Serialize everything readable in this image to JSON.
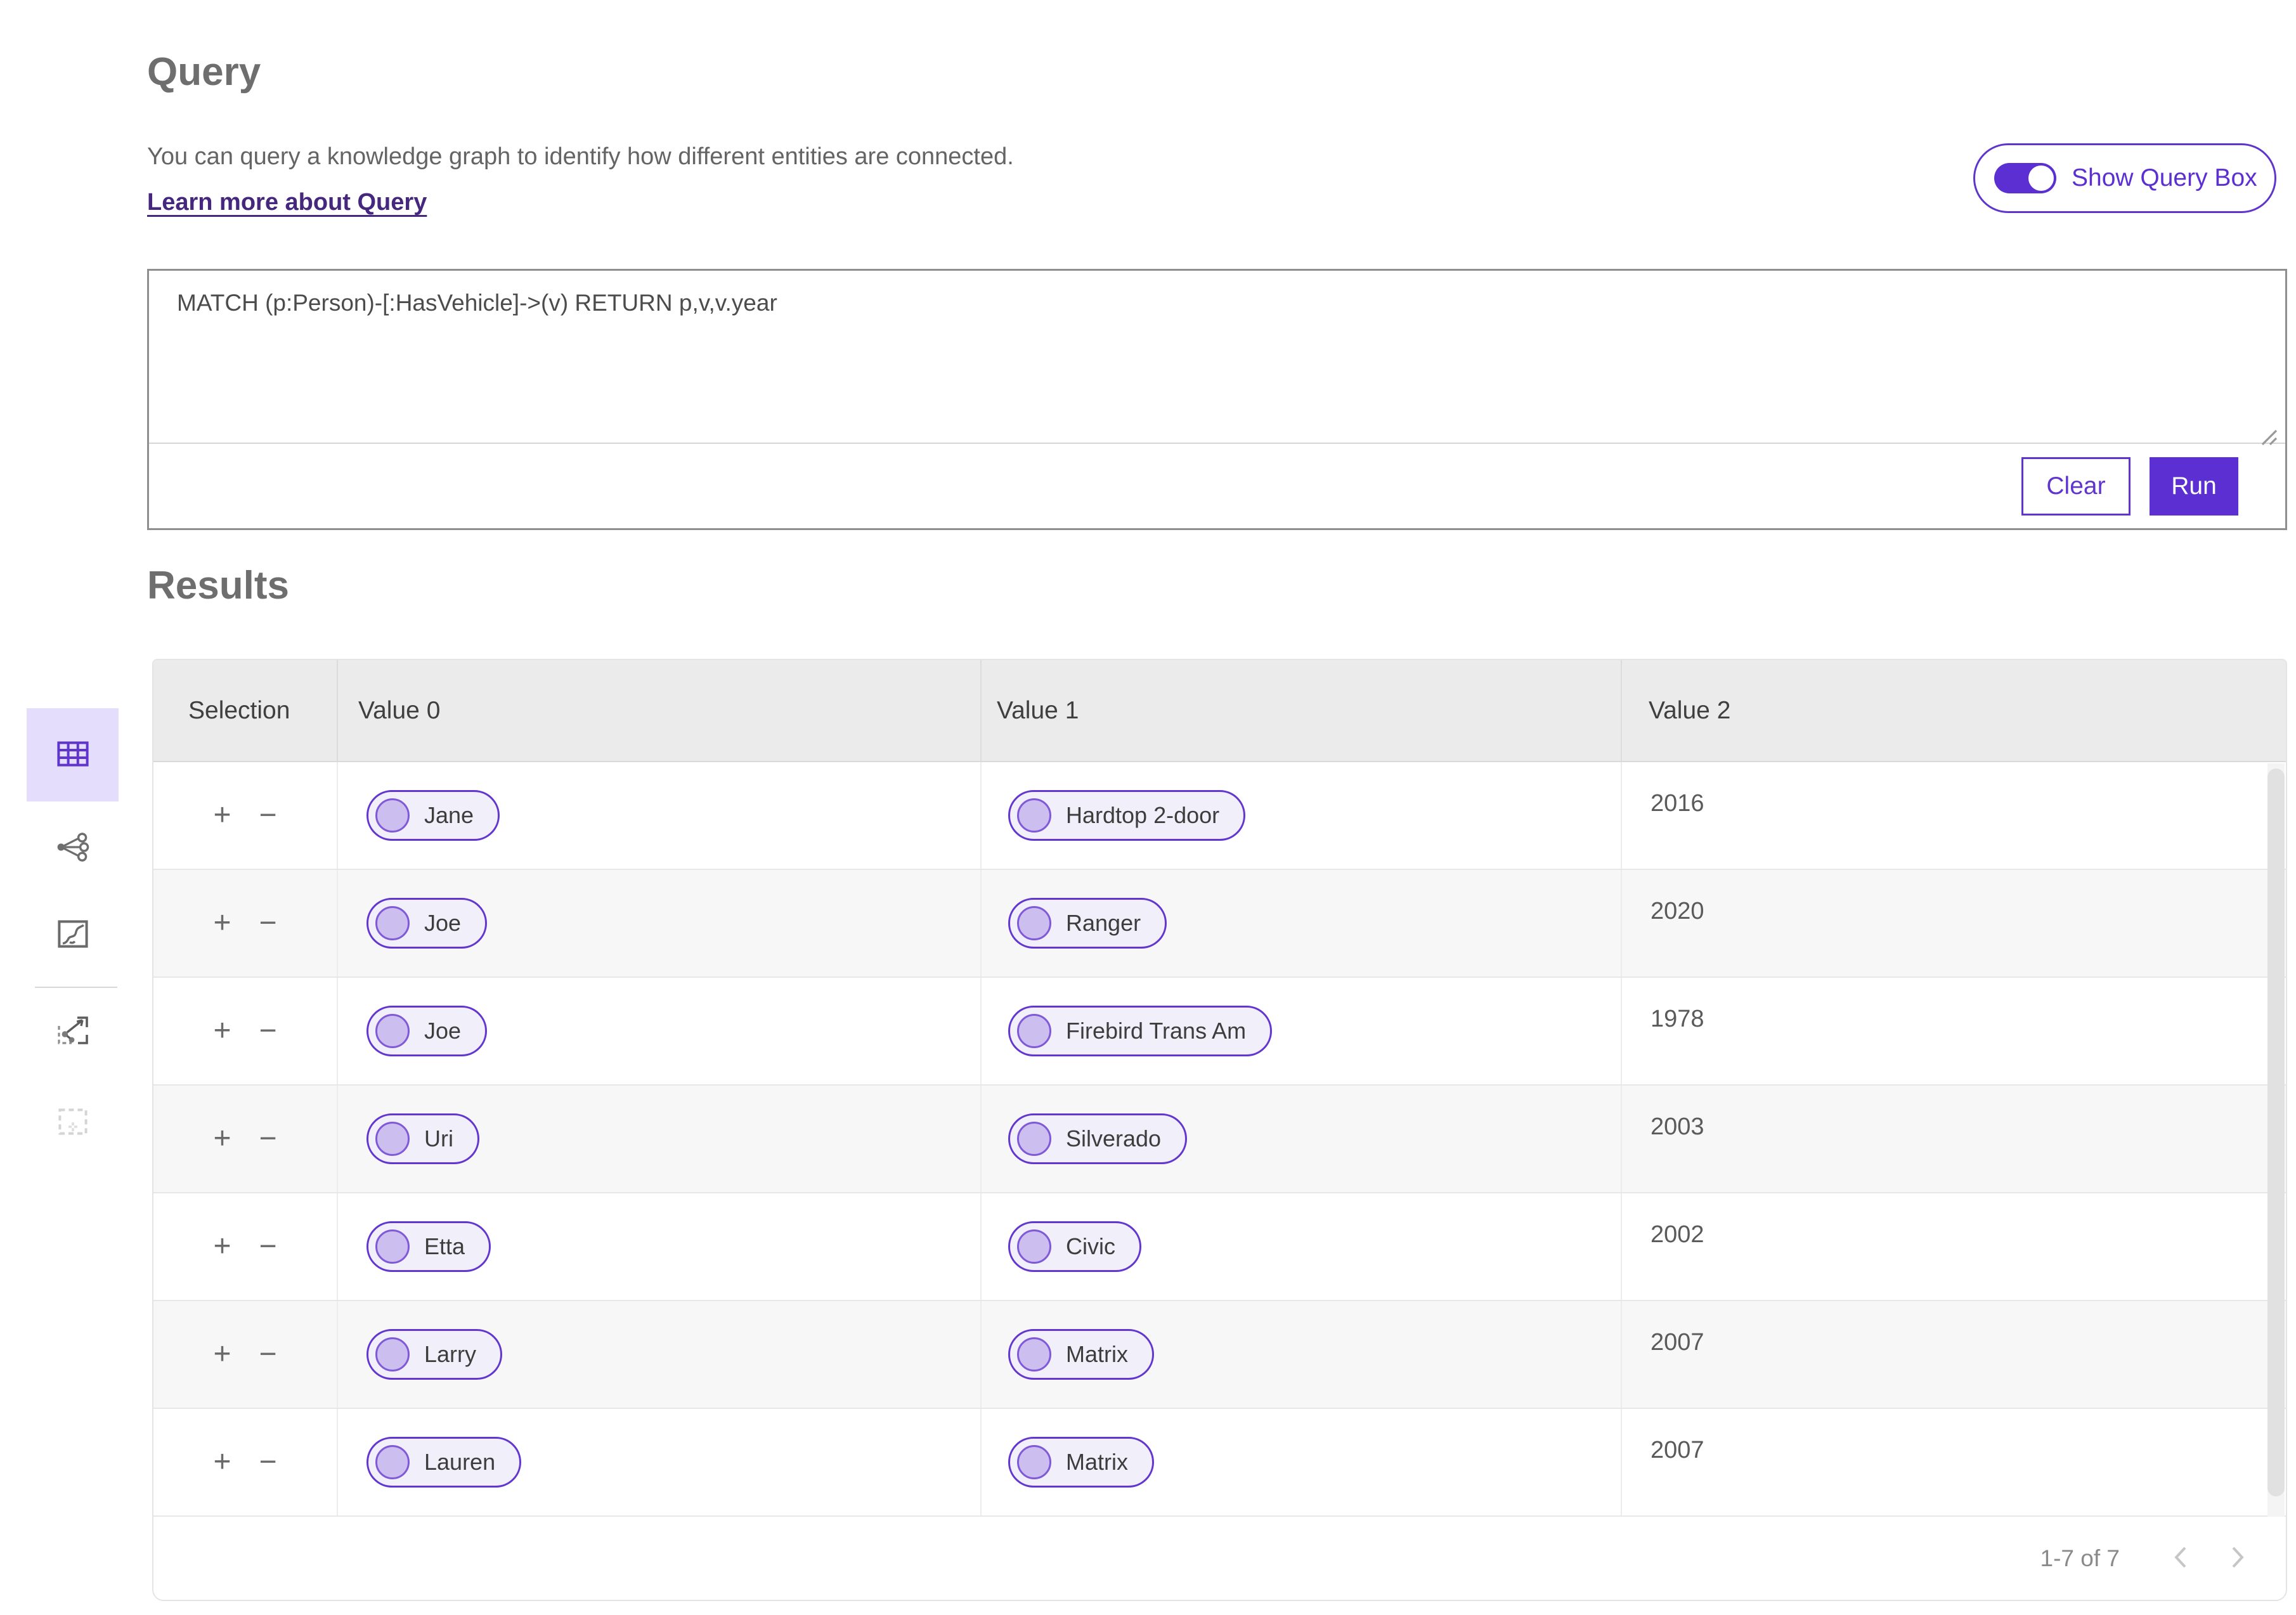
{
  "colors": {
    "accent_purple": "#5b2fd2",
    "pill_border_purple": "#6236cf",
    "link_purple": "#45277e",
    "selected_icon_bg": "#e4ddfb",
    "table_header_bg": "#ebebeb",
    "row_alt_bg": "#f7f7f7",
    "pill_bg": "#f1eff9",
    "pill_node_fill": "#ccbeee"
  },
  "query_section": {
    "title": "Query",
    "description": "You can query a knowledge graph to identify how different entities are connected.",
    "learn_more_link": "Learn more about Query",
    "toggle": {
      "label": "Show Query Box",
      "state": "on"
    },
    "query_text": "MATCH (p:Person)-[:HasVehicle]->(v) RETURN p,v,v.year",
    "clear_button": "Clear",
    "run_button": "Run"
  },
  "results_section": {
    "title": "Results",
    "columns": [
      "Selection",
      "Value 0",
      "Value 1",
      "Value 2"
    ],
    "row_actions": {
      "add": "+",
      "remove": "−"
    },
    "rows": [
      {
        "value0": "Jane",
        "value1": "Hardtop 2-door",
        "value2": "2016"
      },
      {
        "value0": "Joe",
        "value1": "Ranger",
        "value2": "2020"
      },
      {
        "value0": "Joe",
        "value1": "Firebird Trans Am",
        "value2": "1978"
      },
      {
        "value0": "Uri",
        "value1": "Silverado",
        "value2": "2003"
      },
      {
        "value0": "Etta",
        "value1": "Civic",
        "value2": "2002"
      },
      {
        "value0": "Larry",
        "value1": "Matrix",
        "value2": "2007"
      },
      {
        "value0": "Lauren",
        "value1": "Matrix",
        "value2": "2007"
      }
    ],
    "pagination": {
      "range_label": "1-7 of 7"
    }
  },
  "sidebar": {
    "items": [
      {
        "icon": "table-view-icon",
        "selected": true,
        "disabled": false
      },
      {
        "icon": "network-view-icon",
        "selected": false,
        "disabled": false
      },
      {
        "icon": "map-view-icon",
        "selected": false,
        "disabled": false
      },
      {
        "icon": "graph-extract-icon",
        "selected": false,
        "disabled": false
      },
      {
        "icon": "selection-tool-icon",
        "selected": false,
        "disabled": true
      }
    ]
  },
  "icons": {
    "prev_page": "chevron-left-icon",
    "next_page": "chevron-right-icon",
    "resize": "resize-handle-icon"
  }
}
